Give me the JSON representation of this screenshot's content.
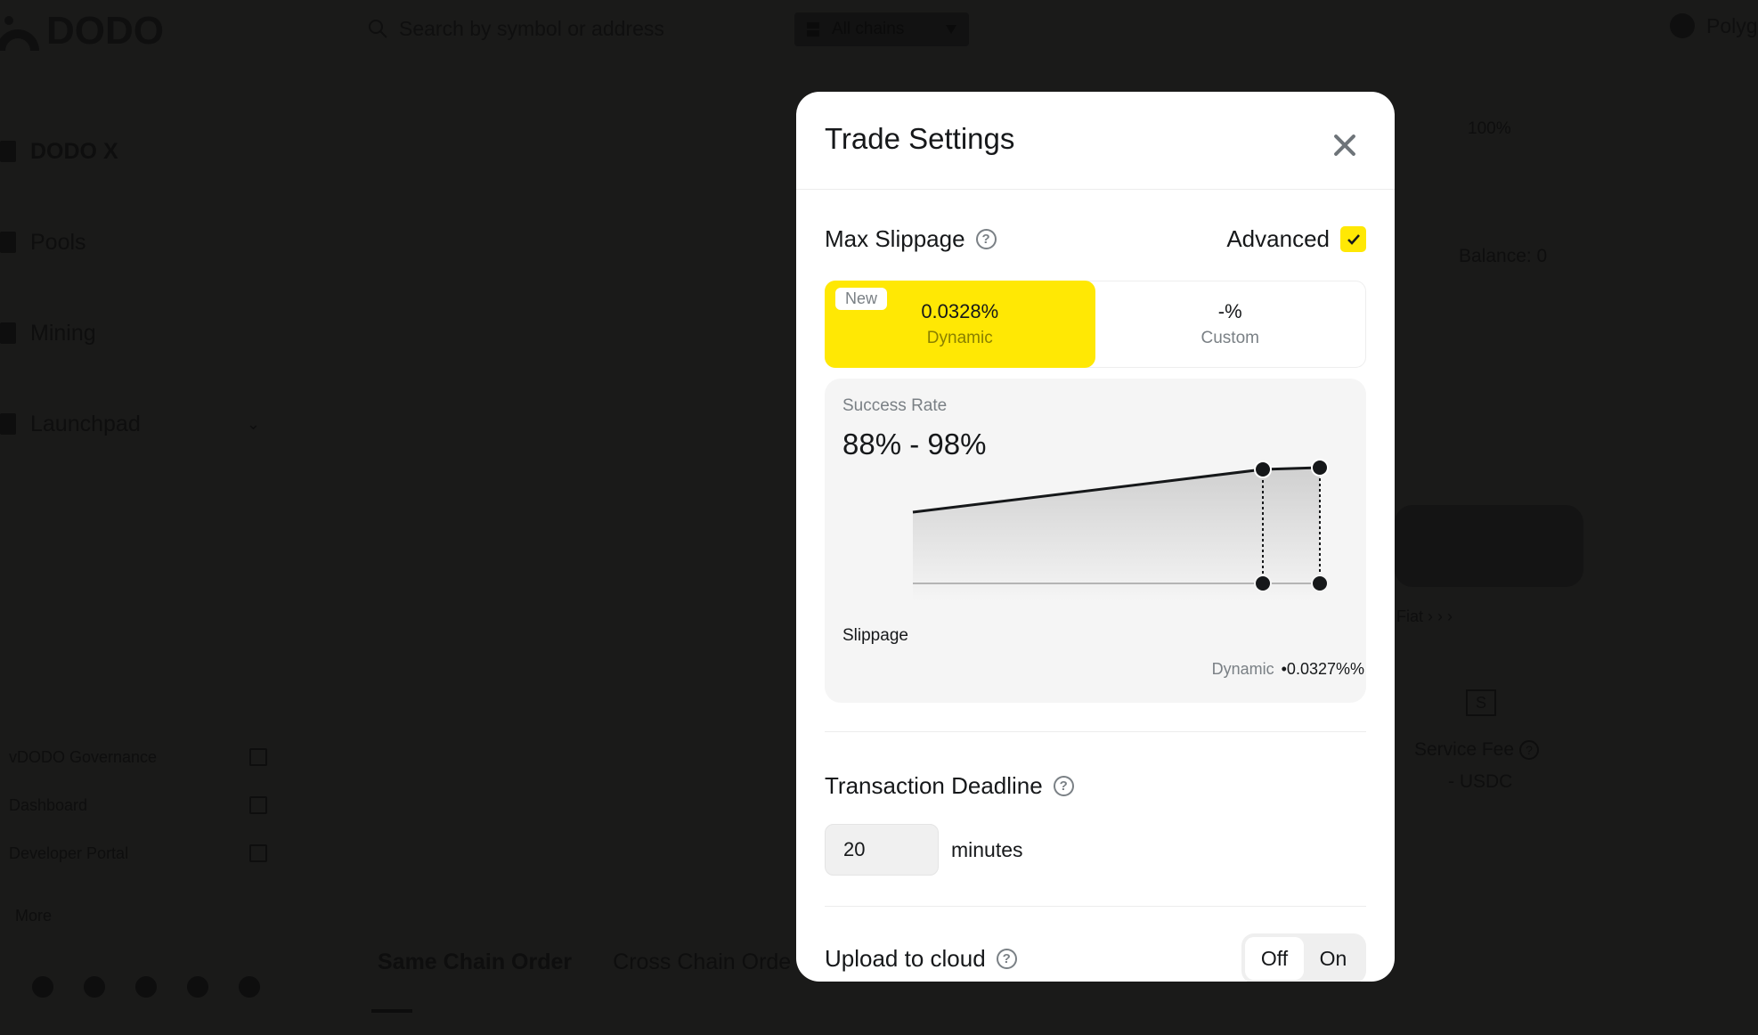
{
  "header": {
    "logo_text": "DODO",
    "search_placeholder": "Search by symbol or address",
    "chain_selector": "All chains",
    "network_label": "Polyg"
  },
  "sidebar": {
    "items": [
      {
        "label": "DODO X"
      },
      {
        "label": "Pools"
      },
      {
        "label": "Mining"
      },
      {
        "label": "Launchpad"
      }
    ],
    "links": [
      {
        "label": "vDODO Governance"
      },
      {
        "label": "Dashboard"
      },
      {
        "label": "Developer Portal"
      }
    ],
    "more_label": "More",
    "socials": [
      "github-icon",
      "twitter-icon",
      "discord-icon",
      "telegram-icon",
      "medium-icon"
    ]
  },
  "main": {
    "order_tabs": [
      {
        "label": "Same Chain Order",
        "active": true
      },
      {
        "label": "Cross Chain Orde",
        "active": false
      }
    ]
  },
  "right_panel": {
    "percent": "100%",
    "balance": "Balance: 0",
    "fiat_link": "Fiat › › ›",
    "fee_icon": "S",
    "service_fee_label": "Service Fee",
    "service_fee_value": "- USDC"
  },
  "modal": {
    "title": "Trade Settings",
    "max_slippage": {
      "label": "Max Slippage",
      "advanced_label": "Advanced",
      "advanced_checked": true,
      "options": [
        {
          "badge": "New",
          "value": "0.0328%",
          "label": "Dynamic",
          "active": true
        },
        {
          "value": "-%",
          "label": "Custom",
          "active": false
        }
      ]
    },
    "success_rate": {
      "label": "Success Rate",
      "range": "88% - 98%",
      "slippage_label": "Slippage",
      "footer_key": "Dynamic",
      "footer_value": "•0.0327%%"
    },
    "transaction_deadline": {
      "label": "Transaction Deadline",
      "value": "20",
      "unit": "minutes"
    },
    "upload_to_cloud": {
      "label": "Upload to cloud",
      "options": [
        "Off",
        "On"
      ],
      "selected": "Off"
    }
  },
  "colors": {
    "accent": "#ffe804",
    "background": "#1a1a19",
    "modal_bg": "#ffffff",
    "chart_card_bg": "#f5f5f5",
    "text_primary": "#16181a",
    "text_secondary": "#7a8085"
  },
  "chart_data": {
    "type": "area",
    "title": "Success Rate",
    "xlabel": "Slippage",
    "ylabel": "Success Rate",
    "series": [
      {
        "name": "success-rate",
        "x": [
          0,
          0.86,
          1.0
        ],
        "y": [
          88,
          97.6,
          98
        ]
      }
    ],
    "markers": [
      {
        "name": "dynamic-point",
        "x": 0.86,
        "y": 97.6
      },
      {
        "name": "max-point",
        "x": 1.0,
        "y": 98
      }
    ],
    "ylim": [
      80,
      98
    ],
    "xlim": [
      0,
      1
    ],
    "range_label": "88% - 98%",
    "grid": false,
    "legend": "none"
  }
}
